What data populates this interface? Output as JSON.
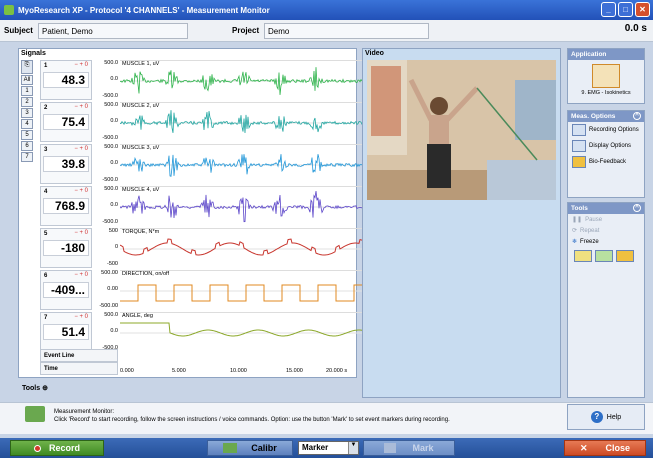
{
  "window": {
    "title": "MyoResearch XP - Protocol '4 CHANNELS' - Measurement Monitor"
  },
  "header": {
    "subject_label": "Subject",
    "subject_value": "Patient, Demo",
    "project_label": "Project",
    "project_value": "Demo",
    "elapsed": "0.0 s"
  },
  "signals": {
    "title": "Signals",
    "vtabs": [
      "All",
      "1",
      "2",
      "3",
      "4",
      "5",
      "6",
      "7"
    ],
    "channels": [
      {
        "num": "1",
        "ctl": "− + 0",
        "value": "48.3",
        "label": "MUSCLE 1, uV",
        "scale": [
          "500.0",
          "0.0",
          "-500.0"
        ],
        "color": "#2db34a"
      },
      {
        "num": "2",
        "ctl": "− + 0",
        "value": "75.4",
        "label": "MUSCLE 2, uV",
        "scale": [
          "500.0",
          "0.0",
          "-500.0"
        ],
        "color": "#1fa5a0"
      },
      {
        "num": "3",
        "ctl": "− + 0",
        "value": "39.8",
        "label": "MUSCLE 3, uV",
        "scale": [
          "500.0",
          "0.0",
          "-500.0"
        ],
        "color": "#2096d8"
      },
      {
        "num": "4",
        "ctl": "− + 0",
        "value": "768.9",
        "label": "MUSCLE 4, uV",
        "scale": [
          "500.0",
          "0.0",
          "-500.0"
        ],
        "color": "#5b45c9"
      },
      {
        "num": "5",
        "ctl": "− + 0",
        "value": "-180",
        "label": "TORQUE, N*m",
        "scale": [
          "500",
          "0",
          "-500"
        ],
        "color": "#c8352d"
      },
      {
        "num": "6",
        "ctl": "− + 0",
        "value": "-409...",
        "label": "DIRECTION, on/off",
        "scale": [
          "500.00",
          "0.00",
          "-500.00"
        ],
        "color": "#e08a20"
      },
      {
        "num": "7",
        "ctl": "− + 0",
        "value": "51.4",
        "label": "ANGLE, deg",
        "scale": [
          "500.0",
          "0.0",
          "-500.0"
        ],
        "color": "#8ca82a"
      }
    ],
    "event_line": "Event Line",
    "time_label": "Time",
    "time_ticks": [
      "0.000",
      "5.000",
      "10.000",
      "15.000",
      "20.000 s"
    ]
  },
  "tools_label": "Tools",
  "video": {
    "title": "Video"
  },
  "application": {
    "title": "Application",
    "item": "9. EMG - Isokinetics"
  },
  "meas_options": {
    "title": "Meas. Options",
    "items": [
      "Recording Options",
      "Display Options",
      "Bio-Feedback"
    ]
  },
  "tools": {
    "title": "Tools",
    "items": [
      "Pause",
      "Repeat",
      "Freeze"
    ]
  },
  "status": {
    "line1": "Measurement Monitor:",
    "line2": "Click 'Record' to start recording, follow the screen instructions / voice commands. Option: use the button 'Mark' to set event markers during recording."
  },
  "help_label": "Help",
  "buttons": {
    "record": "Record",
    "calibr": "Calibr",
    "marker": "Marker",
    "mark": "Mark",
    "close": "Close"
  }
}
